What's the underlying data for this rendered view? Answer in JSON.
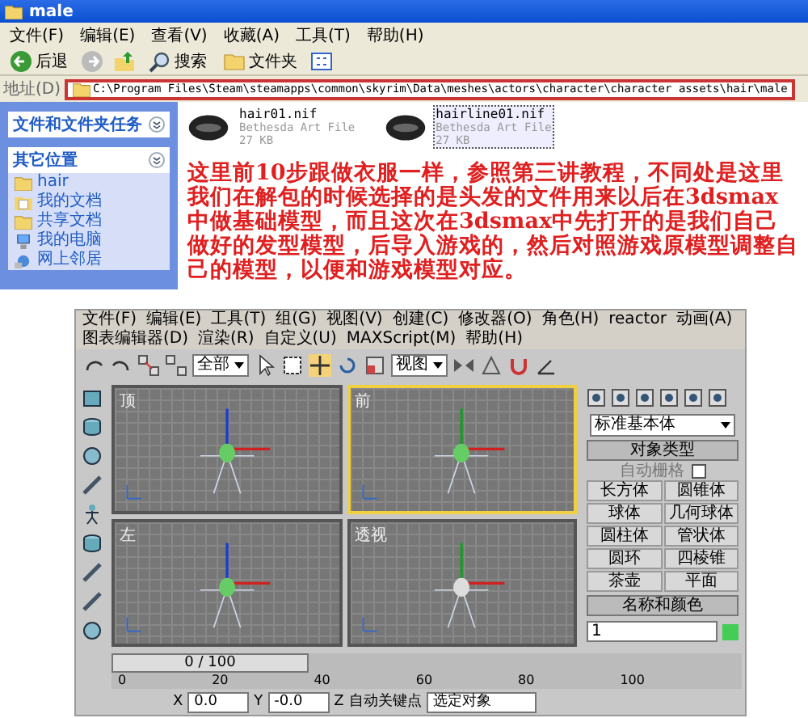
{
  "explorer": {
    "title": "male",
    "menu": [
      "文件(F)",
      "编辑(E)",
      "查看(V)",
      "收藏(A)",
      "工具(T)",
      "帮助(H)"
    ],
    "toolbar": [
      {
        "kind": "back",
        "label": "后退"
      },
      {
        "kind": "forward"
      },
      {
        "kind": "up"
      },
      {
        "kind": "search",
        "label": "搜索"
      },
      {
        "kind": "folders",
        "label": "文件夹"
      },
      {
        "kind": "views"
      }
    ],
    "address": {
      "label": "地址(D)",
      "path": "C:\\Program Files\\Steam\\steamapps\\common\\skyrim\\Data\\meshes\\actors\\character\\character assets\\hair\\male"
    },
    "side_panels": [
      {
        "title": "文件和文件夹任务"
      },
      {
        "title": "其它位置",
        "items": [
          {
            "kind": "folder",
            "label": "hair"
          },
          {
            "kind": "documents",
            "label": "我的文档"
          },
          {
            "kind": "folder",
            "label": "共享文档"
          },
          {
            "kind": "computer",
            "label": "我的电脑"
          },
          {
            "kind": "network",
            "label": "网上邻居"
          }
        ]
      }
    ],
    "files": [
      {
        "name": "hair01.nif",
        "type": "Bethesda Art File",
        "size": "27 KB",
        "selected": false
      },
      {
        "name": "hairline01.nif",
        "type": "Bethesda Art File",
        "size": "27 KB",
        "selected": true
      }
    ]
  },
  "caption": "这里前10步跟做衣服一样，参照第三讲教程，不同处是这里我们在解包的时候选择的是头发的文件用来以后在3dsmax中做基础模型，而且这次在3dsmax中先打开的是我们自己做好的发型模型，后导入游戏的，然后对照游戏原模型调整自己的模型，以便和游戏模型对应。",
  "max": {
    "menu": [
      "文件(F)",
      "编辑(E)",
      "工具(T)",
      "组(G)",
      "视图(V)",
      "创建(C)",
      "修改器(O)",
      "角色(H)",
      "reactor",
      "动画(A)",
      "图表编辑器(D)",
      "渲染(R)",
      "自定义(U)",
      "MAXScript(M)",
      "帮助(H)"
    ],
    "toolbar": {
      "selection_filter": "全部",
      "reference_coord": "视图"
    },
    "viewports": [
      {
        "label": "顶",
        "active": false
      },
      {
        "label": "前",
        "active": true
      },
      {
        "label": "左",
        "active": false
      },
      {
        "label": "透视",
        "active": false
      }
    ],
    "command_panel": {
      "category": "标准基本体",
      "object_type": {
        "title": "对象类型",
        "autogrid": {
          "label": "自动栅格",
          "checked": false
        },
        "buttons": [
          "长方体",
          "圆锥体",
          "球体",
          "几何球体",
          "圆柱体",
          "管状体",
          "圆环",
          "四棱锥",
          "茶壶",
          "平面"
        ]
      },
      "name_color": {
        "title": "名称和颜色",
        "value": "1",
        "color": "#44cc55"
      }
    },
    "timeline": {
      "position": "0 / 100",
      "ticks": [
        "0",
        "20",
        "40",
        "60",
        "80",
        "100"
      ]
    },
    "status": {
      "fields": [
        {
          "label": "X",
          "value": "0.0"
        },
        {
          "label": "Y",
          "value": "-0.0"
        },
        {
          "label": "Z"
        }
      ],
      "auto_key": "自动关键点",
      "selection": "选定对象"
    }
  }
}
